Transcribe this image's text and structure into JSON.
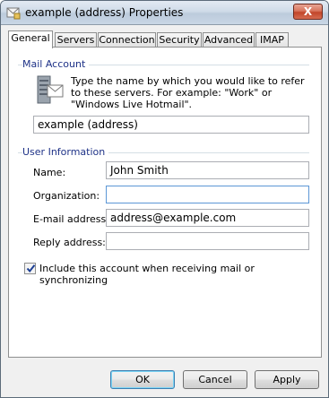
{
  "window": {
    "title": "example (address) Properties",
    "close_glyph": "X",
    "icon": "mail-properties-icon"
  },
  "tabs": [
    {
      "label": "General",
      "active": true
    },
    {
      "label": "Servers",
      "active": false
    },
    {
      "label": "Connection",
      "active": false
    },
    {
      "label": "Security",
      "active": false
    },
    {
      "label": "Advanced",
      "active": false
    },
    {
      "label": "IMAP",
      "active": false
    }
  ],
  "mail_account": {
    "group_label": "Mail Account",
    "description": "Type the name by which you would like to refer to these servers.  For example: \"Work\" or \"Windows Live Hotmail\".",
    "account_name": "example (address)",
    "icon": "mail-server-icon"
  },
  "user_information": {
    "group_label": "User Information",
    "name_label": "Name:",
    "name_value": "John Smith",
    "organization_label": "Organization:",
    "organization_value": "",
    "email_label": "E-mail address:",
    "email_value": "address@example.com",
    "reply_label": "Reply address:",
    "reply_value": ""
  },
  "include_checkbox": {
    "label": "Include this account when receiving mail or synchronizing",
    "checked": true
  },
  "buttons": {
    "ok": "OK",
    "cancel": "Cancel",
    "apply": "Apply"
  },
  "colors": {
    "group_label": "#1e3287",
    "focus_border": "#5c97d6",
    "close_button": "#c2452a"
  }
}
